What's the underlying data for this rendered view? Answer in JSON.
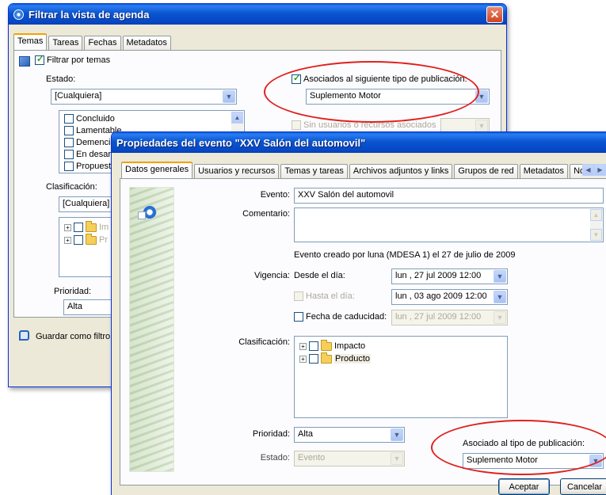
{
  "filter_window": {
    "title": "Filtrar la vista de agenda",
    "close": "✕",
    "tabs": [
      "Temas",
      "Tareas",
      "Fechas",
      "Metadatos"
    ],
    "filter_by_topics": "Filtrar por temas",
    "estado_label": "Estado:",
    "estado_value": "[Cualquiera]",
    "estado_options": [
      "Concluido",
      "Lamentable",
      "Demencial",
      "En desarr",
      "Propuesta"
    ],
    "pub_type_check": "Asociados al siguiente tipo de publicación:",
    "pub_type_value": "Suplemento Motor",
    "no_users_check": "Sin usuarios o recursos asociados",
    "clasificacion_label": "Clasificación:",
    "clasificacion_value": "[Cualquiera]",
    "tree_items": [
      "Im",
      "Pr"
    ],
    "prioridad_label": "Prioridad:",
    "prioridad_value": "Alta",
    "save_filter": "Guardar como filtro pr"
  },
  "event_window": {
    "title": "Propiedades del evento \"XXV Salón del automovil\"",
    "tabs": [
      "Datos generales",
      "Usuarios y recursos",
      "Temas y tareas",
      "Archivos adjuntos y links",
      "Grupos de red",
      "Metadatos",
      "Notificaciones"
    ],
    "evento_label": "Evento:",
    "evento_value": "XXV Salón del automovil",
    "comentario_label": "Comentario:",
    "created_info": "Evento creado por luna (MDESA 1) el 27 de julio de 2009",
    "vigencia_label": "Vigencia:",
    "desde_label": "Desde el día:",
    "desde_value": "lun , 27  jul  2009  12:00",
    "hasta_label": "Hasta el día:",
    "hasta_value": "lun , 03 ago 2009  12:00",
    "caducidad_label": "Fecha de caducidad:",
    "caducidad_value": "lun , 27  jul  2009  12:00",
    "clasificacion_label": "Clasificación:",
    "tree_items": [
      "Impacto",
      "Producto"
    ],
    "prioridad_label": "Prioridad:",
    "prioridad_value": "Alta",
    "estado_label": "Estado:",
    "estado_value": "Evento",
    "pub_type_label": "Asociado al tipo de publicación:",
    "pub_type_value": "Suplemento Motor",
    "accept": "Aceptar",
    "cancel": "Cancelar"
  },
  "colors": {
    "highlight_ellipse": "#e0201e",
    "xp_title": "#0a55d0"
  }
}
